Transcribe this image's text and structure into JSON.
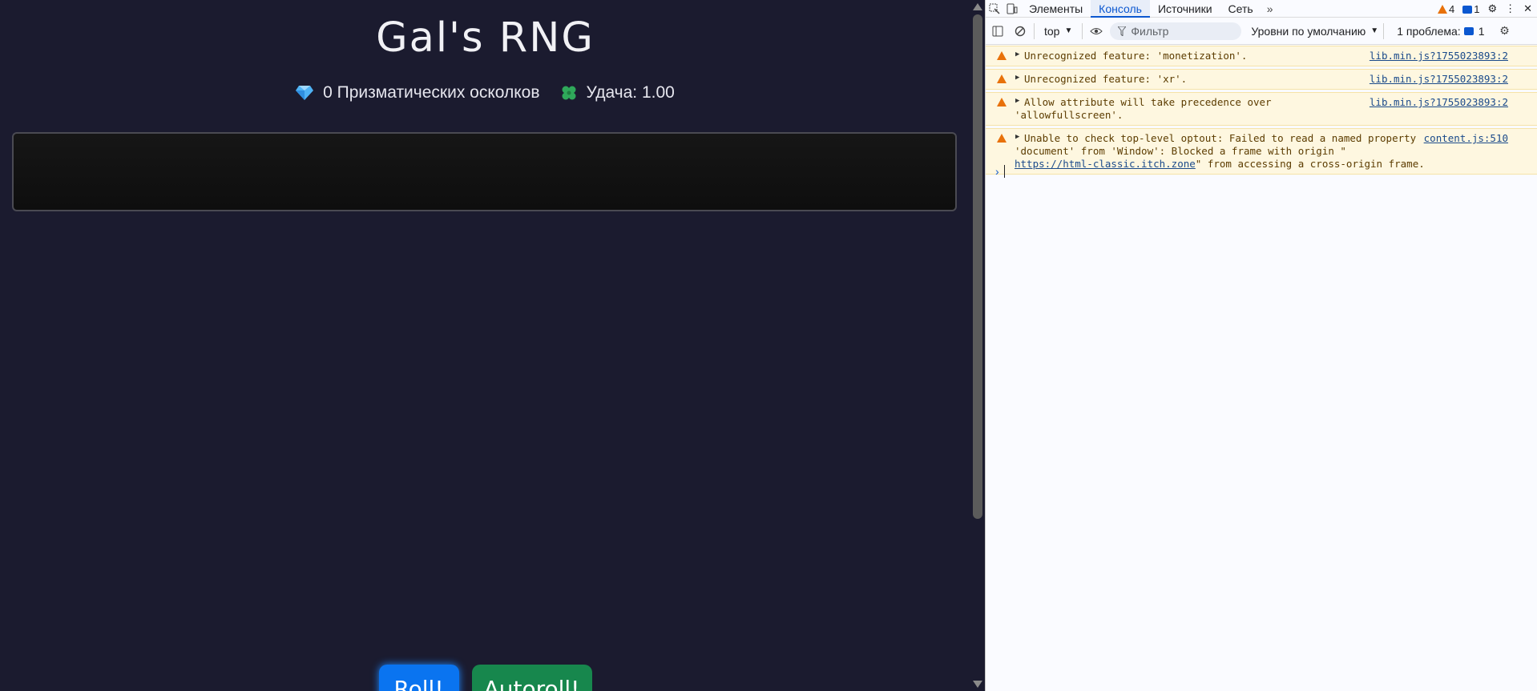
{
  "game": {
    "title": "Gal's RNG",
    "shards_text": "0 Призматических осколков",
    "luck_text": "Удача: 1.00",
    "roll_label": "Roll!",
    "autoroll_label": "Autoroll!"
  },
  "devtools": {
    "tabs": [
      "Элементы",
      "Консоль",
      "Источники",
      "Сеть"
    ],
    "active_tab": "Консоль",
    "warning_count": "4",
    "message_count": "1",
    "context": "top",
    "filter_placeholder": "Фильтр",
    "levels_label": "Уровни по умолчанию",
    "issues_label": "1 проблема:",
    "issues_count": "1",
    "messages": [
      {
        "line1": "Unrecognized feature: 'monetization'.",
        "source": "lib.min.js?1755023893:2"
      },
      {
        "line1": "Unrecognized feature: 'xr'.",
        "source": "lib.min.js?1755023893:2"
      },
      {
        "line1": "Allow attribute will take precedence over",
        "line2": "'allowfullscreen'.",
        "source": "lib.min.js?1755023893:2"
      },
      {
        "line1": "Unable to check top-level optout: Failed to read a named property",
        "line2": "'document' from 'Window': Blocked a frame with origin \"",
        "link": "https://html-classic.itch.zone",
        "line3_suffix": "\" from accessing a cross-origin frame.",
        "source": "content.js:510"
      }
    ]
  },
  "colors": {
    "game_bg": "#1b1b2f",
    "roll_blue": "#0a74f0",
    "autoroll_green": "#17874d",
    "warning_bg": "#fef7e0",
    "devtools_accent": "#0b57d0"
  }
}
